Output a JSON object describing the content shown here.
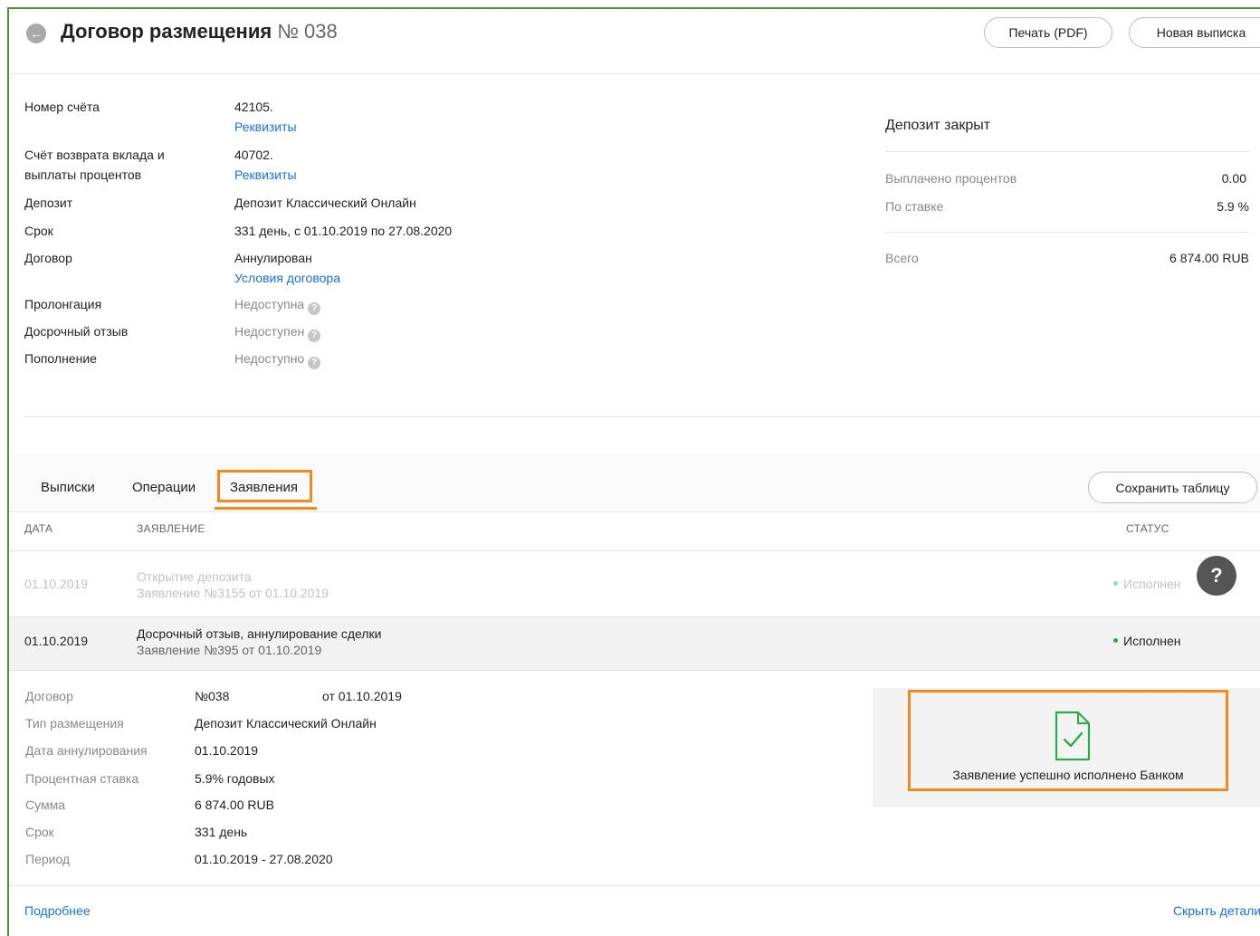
{
  "header": {
    "title": "Договор размещения",
    "number": "№ 038",
    "print_label": "Печать (PDF)",
    "statement_label": "Новая выписка"
  },
  "info": {
    "account_label": "Номер счёта",
    "account_value": "42105.",
    "account_link": "Реквизиты",
    "return_label_1": "Счёт возврата вклада и",
    "return_label_2": "выплаты процентов",
    "return_value": "40702.",
    "return_link": "Реквизиты",
    "deposit_label": "Депозит",
    "deposit_value": "Депозит Классический Онлайн",
    "term_label": "Срок",
    "term_value": "331 день, с 01.10.2019 по 27.08.2020",
    "contract_label": "Договор",
    "contract_value": "Аннулирован",
    "contract_link": "Условия договора",
    "prolong_label": "Пролонгация",
    "prolong_value": "Недоступна",
    "early_label": "Досрочный отзыв",
    "early_value": "Недоступен",
    "topup_label": "Пополнение",
    "topup_value": "Недоступно"
  },
  "summary": {
    "title": "Депозит закрыт",
    "paid_label": "Выплачено процентов",
    "paid_value": "0.00",
    "rate_label": "По ставке",
    "rate_value": "5.9 %",
    "total_label": "Всего",
    "total_value": "6 874.00 RUB"
  },
  "tabs": {
    "statements": "Выписки",
    "operations": "Операции",
    "applications": "Заявления",
    "save_table": "Сохранить таблицу"
  },
  "table": {
    "col_date": "ДАТА",
    "col_app": "ЗАЯВЛЕНИЕ",
    "col_status": "СТАТУС",
    "rows": [
      {
        "date": "01.10.2019",
        "title": "Открытие депозита",
        "sub": "Заявление №3155 от 01.10.2019",
        "status": "Исполнен"
      },
      {
        "date": "01.10.2019",
        "title": "Досрочный отзыв, аннулирование сделки",
        "sub": "Заявление №395 от 01.10.2019",
        "status": "Исполнен"
      }
    ]
  },
  "details": {
    "contract_label": "Договор",
    "contract_num": "№038",
    "contract_date": "от 01.10.2019",
    "type_label": "Тип размещения",
    "type_value": "Депозит Классический Онлайн",
    "cancel_label": "Дата аннулирования",
    "cancel_value": "01.10.2019",
    "rate_label": "Процентная ставка",
    "rate_value": "5.9% годовых",
    "sum_label": "Сумма",
    "sum_value": "6 874.00 RUB",
    "term_label": "Срок",
    "term_value": "331 день",
    "period_label": "Период",
    "period_value": "01.10.2019 - 27.08.2020",
    "success_text": "Заявление успешно исполнено Банком"
  },
  "footer": {
    "more": "Подробнее",
    "hide": "Скрыть детали"
  },
  "colors": {
    "accent_orange": "#f08a1f",
    "link_blue": "#1f6fd1",
    "success_green": "#2eaa4c"
  },
  "help_icon": "?"
}
